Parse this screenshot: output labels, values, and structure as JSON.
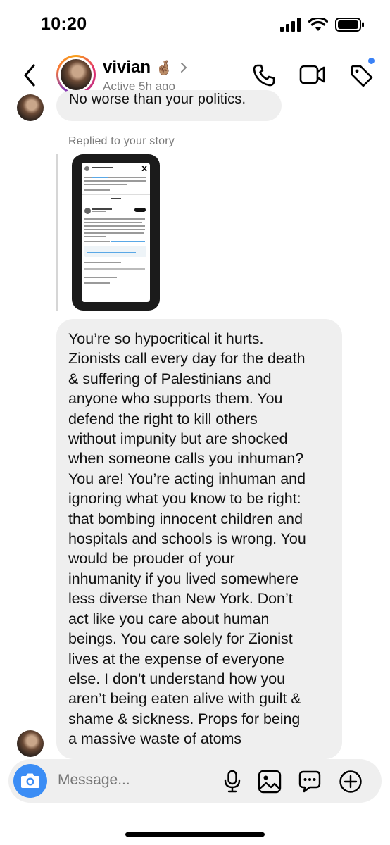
{
  "status_bar": {
    "time": "10:20"
  },
  "header": {
    "name": "vivian",
    "name_emoji": "🤞🏽",
    "status": "Active 5h ago",
    "notification_dot_color": "#3b82f6"
  },
  "thread": {
    "previous_message": "No worse than your politics.",
    "reply_label": "Replied to your story",
    "main_message": "You’re so hypocritical it hurts.\nZionists call every day for the death\n& suffering of Palestinians and\nanyone who supports them. You\ndefend the right to kill others\nwithout impunity but are shocked\nwhen someone calls you inhuman?\nYou are! You’re acting inhuman and\nignoring what you know to be right:\nthat bombing innocent children and\nhospitals and schools is wrong. You\nwould be prouder of your\ninhumanity if you lived somewhere\nless diverse than New York. Don’t\nact like you care about human\nbeings. You care solely for Zionist\nlives at the expense of everyone\nelse. I don’t understand how you\naren’t being eaten alive with guilt &\nshame & sickness. Props for being\na massive waste of atoms"
  },
  "composer": {
    "placeholder": "Message...",
    "camera_color": "#3b8df5"
  },
  "icons": {
    "back": "chevron-left-icon",
    "call": "phone-icon",
    "video": "video-camera-icon",
    "tag": "tag-icon",
    "mic": "microphone-icon",
    "gallery": "image-icon",
    "sticker": "chat-bubble-icon",
    "more": "plus-circle-icon"
  }
}
